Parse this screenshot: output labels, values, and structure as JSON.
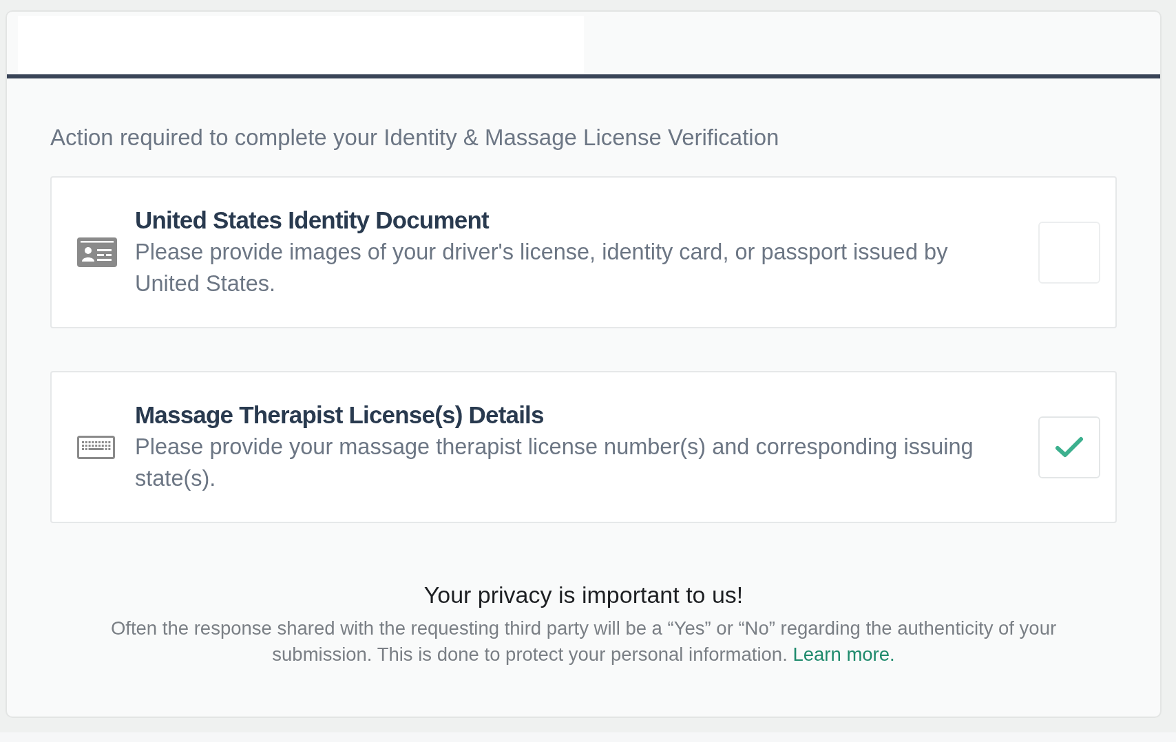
{
  "instruction": "Action required to complete your Identity & Massage License Verification",
  "requirements": [
    {
      "kind": "id-card",
      "title": "United States Identity Document",
      "description": "Please provide images of your driver's license, identity card, or passport issued by United States.",
      "checked": false
    },
    {
      "kind": "keyboard",
      "title": "Massage Therapist License(s) Details",
      "description": "Please provide your massage therapist license number(s) and corresponding issuing state(s).",
      "checked": true
    }
  ],
  "privacy": {
    "title": "Your privacy is important to us!",
    "text": "Often the response shared with the requesting third party will be a “Yes” or “No” regarding the authenticity of your submission. This is done to protect your personal information.",
    "link": "Learn more."
  }
}
